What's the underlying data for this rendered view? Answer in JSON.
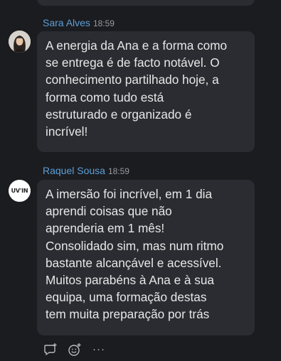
{
  "messages": [
    {
      "sender": "Sara Alves",
      "time": "18:59",
      "avatar": "profile-photo",
      "text": "A energia da Ana e a forma como\nse entrega é de facto notável. O\nconhecimento partilhado hoje, a\nforma como tudo está\nestruturado e organizado é\nincrível!"
    },
    {
      "sender": "Raquel Sousa",
      "time": "18:59",
      "avatar": "uvin-logo",
      "avatar_text": "UV'IN",
      "text": "A imersão foi incrível, em 1 dia\naprendi coisas que não\naprenderia em 1 mês!\nConsolidado sim, mas num ritmo\nbastante alcançável e acessível.\nMuitos parabéns à Ana e à sua\nequipa, uma formação destas\ntem muita preparação por trás"
    }
  ],
  "actions": {
    "reply_icon": "reply-thread-icon",
    "reaction_icon": "add-reaction-icon",
    "more_icon": "more-options-icon",
    "more_label": "···"
  },
  "colors": {
    "background": "#1b1c20",
    "bubble": "#2b2c31",
    "sender": "#5c9fd6",
    "timestamp": "#9a9ba0"
  }
}
